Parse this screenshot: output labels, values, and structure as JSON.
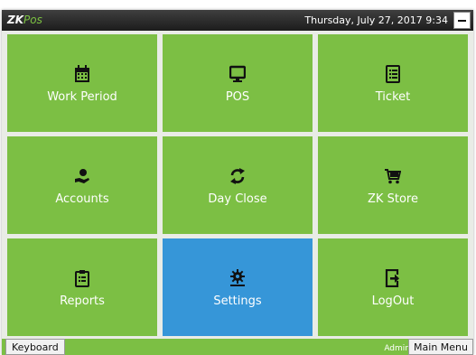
{
  "titlebar": {
    "logo_zk": "ZK",
    "logo_pos": "Pos",
    "datetime": "Thursday, July 27, 2017 9:34"
  },
  "tiles": [
    {
      "label": "Work Period",
      "icon": "calendar-icon"
    },
    {
      "label": "POS",
      "icon": "monitor-icon"
    },
    {
      "label": "Ticket",
      "icon": "ticket-icon"
    },
    {
      "label": "Accounts",
      "icon": "hand-coin-icon"
    },
    {
      "label": "Day Close",
      "icon": "refresh-icon"
    },
    {
      "label": "ZK Store",
      "icon": "cart-icon"
    },
    {
      "label": "Reports",
      "icon": "clipboard-icon"
    },
    {
      "label": "Settings",
      "icon": "gear-icon",
      "active": true
    },
    {
      "label": "LogOut",
      "icon": "logout-icon"
    }
  ],
  "footer": {
    "keyboard_label": "Keyboard",
    "user": "Admin",
    "main_menu_label": "Main Menu"
  },
  "colors": {
    "tile_green": "#7cbf44",
    "tile_active_blue": "#3696d8",
    "titlebar_dark": "#2b2b2b"
  }
}
